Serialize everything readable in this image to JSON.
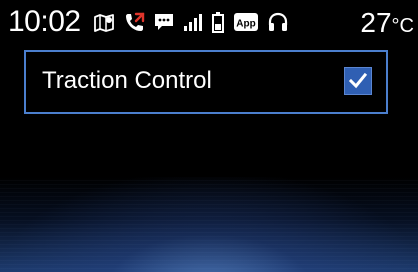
{
  "status_bar": {
    "time": "10:02",
    "temperature": "27",
    "temperature_unit": "°C",
    "icons": [
      "map-icon",
      "missed-call-icon",
      "message-icon",
      "signal-icon",
      "battery-icon",
      "app-icon",
      "headset-icon"
    ],
    "app_icon_text": "App"
  },
  "setting": {
    "label": "Traction Control",
    "checked": true
  },
  "colors": {
    "accent": "#4b7fce",
    "checkbox": "#2f5fb3",
    "missed_call": "#e0352b"
  }
}
